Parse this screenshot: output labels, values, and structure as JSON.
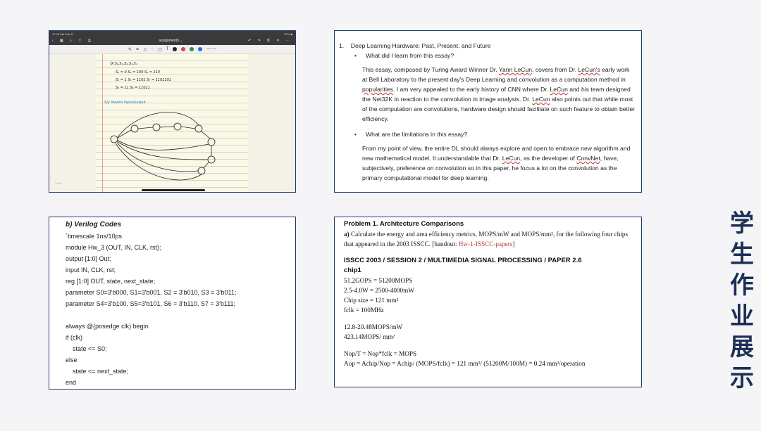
{
  "side_title": [
    "学",
    "生",
    "作",
    "业",
    "展",
    "示"
  ],
  "panel1": {
    "status_left": "17:06  Sat Feb 11",
    "status_right": "87% ■",
    "nav_title": "assignment3 ⌄",
    "page_label": "1 of 3",
    "handwriting": [
      "状 S₀,S₁,S₂,S₃,S₄",
      "S₀ = 0       S₄ = 100      S₆ = 110",
      "S₁ = 1       S₅ = 1101     S₇ = 1101101",
      "S₂ = 11      S₆ = 11011",
      "S/y means input/output"
    ],
    "colors": {
      "red": "#d64541",
      "green": "#2e8b57",
      "blue": "#1e6fd9"
    }
  },
  "panel2": {
    "heading_num": "1.",
    "heading": "Deep Learning Hardware: Past, Present, and Future",
    "q1": "What did I learn from this essay?",
    "p1_a": "This essay, composed by Turing Award Winner Dr. ",
    "p1_b": "Yann LeCun",
    "p1_c": ", covers from Dr. ",
    "p1_d": "LeCun's",
    "p1_e": " early work at Bell Laboratory to the present day's Deep Learning and convolution as a computation method in ",
    "p1_f": "popularities",
    "p1_g": ". I am very appealed to the early history of CNN where Dr. ",
    "p1_h": "LeCun",
    "p1_i": " and his team designed the Net32K in reaction to the convolution in image analysis. Dr. ",
    "p1_j": "LeCun",
    "p1_k": " also points out that while most of the computation are convolutions, hardware design should facilitate on such feature to obtain better efficiency.",
    "q2": "What are the limitations in this essay?",
    "p2_a": "From my point of view, the entire DL should always explore and open to embrace new algorithm and new mathematical model. It understandable that Dr. ",
    "p2_b": "LeCun",
    "p2_c": ", as the developer of ",
    "p2_d": "ConvNet",
    "p2_e": ", have, subjectively, preference on convolution so in this paper, he focus a lot on the convolution as the primary computational model for deep learning."
  },
  "panel3": {
    "title": "b) Verilog Codes",
    "lines": [
      "`timescale 1ns/10ps",
      "module Hw_3 (OUT, IN, CLK, rst);",
      "output [1:0] Out;",
      "input IN, CLK, rst;",
      "reg [1:0] OUT, state, next_state;",
      "parameter S0=3'b000, S1=3'b001, S2 = 3'b010, S3 = 3'b011;",
      "parameter S4=3'b100, S5=3'b101, S6 = 3'b110, S7 = 3'b111;",
      "",
      "always @(posedge clk) begin",
      "if (clk)",
      "    state <= S0;",
      "else",
      "    state <= next_state;",
      "end"
    ]
  },
  "panel4": {
    "title": "Problem 1. Architecture Comparisons",
    "a_label": "a)",
    "a_text": " Calculate the energy and area efficiency metrics, MOPS/mW and MOPS/mm², for the following four chips that appeared in the 2003 ISSCC. [handout: ",
    "a_link": "Hw-1-ISSCC-papers",
    "a_end": "]",
    "session": "ISSCC 2003 / SESSION 2 / MULTIMEDIA SIGNAL PROCESSING / PAPER 2.6",
    "chip": "chip1",
    "lines1": [
      "51.2GOPS = 51200MOPS",
      "2.5-4.0W = 2500-4000mW",
      "Chip size = 121 mm²",
      "fclk = 100MHz"
    ],
    "lines2": [
      "12.8-20.48MOPS/mW",
      "423.14MOPS/ mm²"
    ],
    "lines3": [
      "Nop/T = Nop*fclk = MOPS",
      "Aop = Achip/Nop = Achip/ (MOPS/fclk) = 121 mm²/ (51200M/100M) = 0.24 mm²/operation"
    ]
  }
}
